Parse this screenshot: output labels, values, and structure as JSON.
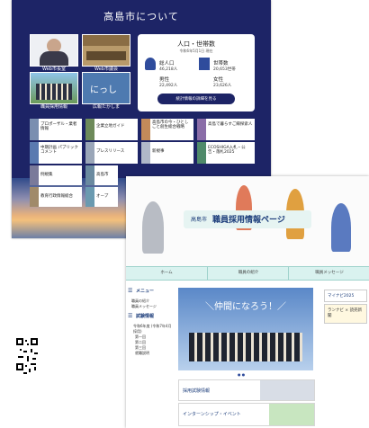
{
  "shot1": {
    "title": "高島市について",
    "thumbnails": [
      {
        "label": "Web市長室",
        "icon": "mayor-photo"
      },
      {
        "label": "Web市議会",
        "icon": "council-photo"
      },
      {
        "label": "職員採用情報",
        "icon": "staff-photo"
      },
      {
        "label": "広報たかしま",
        "icon": "magazine-cover"
      }
    ],
    "population": {
      "title": "人口・世帯数",
      "date": "令和6年5月1日 現在",
      "total_label": "総人口",
      "total_value": "46,218人",
      "households_label": "世帯数",
      "households_value": "20,653世帯",
      "male_label": "男性",
      "male_value": "22,492人",
      "female_label": "女性",
      "female_value": "23,626人",
      "button_label": "統計情報の詳細を見る"
    },
    "links": [
      {
        "text": "プロポーザル・業者情報"
      },
      {
        "text": "企業立地ガイド"
      },
      {
        "text": "高島市の今・ひとしごと創生総合戦略"
      },
      {
        "text": "高島で暮らすご縁探索人"
      },
      {
        "text": "中期計画 パブリックコメント"
      },
      {
        "text": "プレスリリース"
      },
      {
        "text": "新規事"
      },
      {
        "text": "ECOSHIGA入札・公告・落札2025"
      },
      {
        "text": "例規集"
      },
      {
        "text": "高島市"
      },
      {
        "text": "教育行政情報総合"
      },
      {
        "text": "オープ"
      }
    ]
  },
  "shot2": {
    "header_city": "高島市",
    "header_title": "職員採用情報ページ",
    "nav": [
      "ホーム",
      "職員の紹介",
      "職員メッセージ"
    ],
    "menu_title": "メニュー",
    "menu_items": [
      "職員の紹介",
      "職員メッセージ"
    ],
    "exam_title": "試験情報",
    "exam_items": [
      "令和6年度 (令和7年4月採用)",
      "第一回",
      "第二回",
      "第三回",
      "就職説明"
    ],
    "banner_text": "＼仲間になろう！／",
    "section1": "採用試験情報",
    "section2": "インターンシップ・イベント",
    "ad1": "マイナビ2025",
    "ad2": "ランナビ × 読売新聞"
  },
  "colors": {
    "navy": "#1d2466",
    "mint": "#d9f2ef",
    "accent": "#2f4c9c"
  }
}
